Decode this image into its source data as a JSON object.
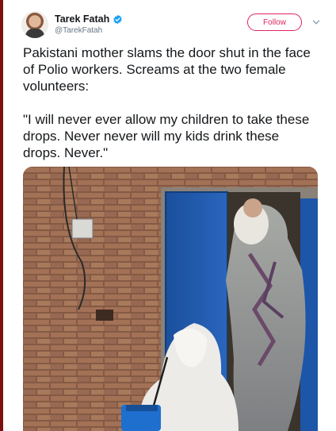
{
  "author": {
    "name": "Tarek Fatah",
    "handle": "@TarekFatah",
    "verified": true
  },
  "actions": {
    "follow_label": "Follow"
  },
  "tweet": {
    "paragraph_1": "Pakistani mother slams the door shut in the face of Polio workers. Screams at the two female volunteers:",
    "paragraph_2": "\"I will never ever allow my children to take these drops. Never never will my kids drink these drops. Never.\""
  },
  "colors": {
    "follow_accent": "#e0245e",
    "verified_badge": "#1da1f2",
    "handle_gray": "#657786",
    "text": "#14171a"
  },
  "icons": {
    "verified": "verified-badge-icon",
    "more": "chevron-down-icon"
  }
}
